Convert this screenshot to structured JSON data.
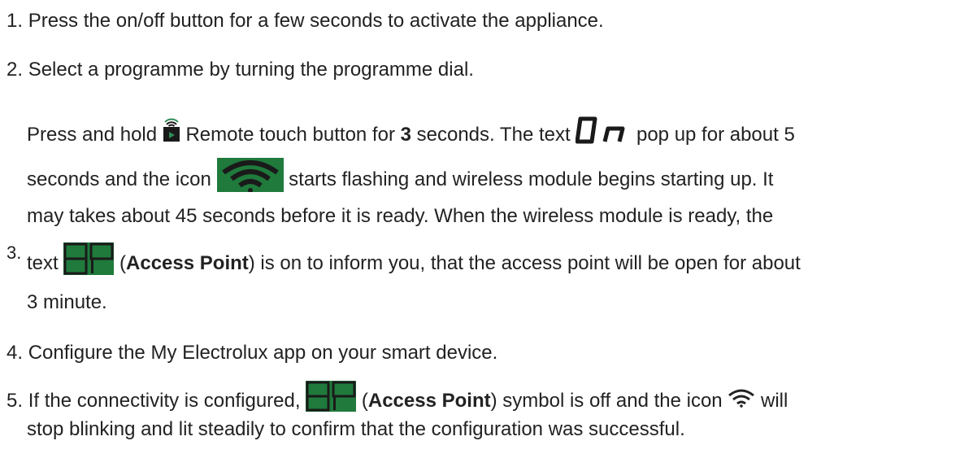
{
  "steps": [
    {
      "num": "1.",
      "text": "Press the on/off button for a few seconds to activate the appliance."
    },
    {
      "num": "2.",
      "text": "Select a programme by turning the programme dial."
    },
    {
      "num": "3.",
      "l1a": "Press and hold ",
      "l1b": " Remote touch button for ",
      "l1bold": "3",
      "l1c": " seconds. The text ",
      "l1d": " pop up for about 5",
      "l2a": "seconds and the icon ",
      "l2b": " starts flashing and wireless module begins starting up. It",
      "l3": "may takes about 45 seconds before it is ready. When the wireless module is ready, the",
      "l4a": "text ",
      "l4b": " (",
      "l4bold": "Access Point",
      "l4c": ") is on to inform you, that the access point will be open for about",
      "l5": "3 minute."
    },
    {
      "num": "4.",
      "text": "Configure the My Electrolux app on your smart device."
    },
    {
      "num": "5.",
      "l1a": "If the connectivity is configured, ",
      "l1b": " (",
      "l1bold": "Access Point",
      "l1c": ") symbol is off and the icon ",
      "l1d": " will",
      "l2": "stop blinking and lit steadily to confirm that the configuration was successful."
    }
  ],
  "icons": {
    "remote_touch": "remote-touch-icon",
    "on_display": "on-display-icon",
    "wifi_green": "wifi-icon",
    "ap_display": "access-point-display-icon",
    "wifi_outline": "wifi-outline-icon"
  },
  "colors": {
    "text": "#222222",
    "icon_green": "#1f7a3c",
    "icon_dark": "#1a1a1a"
  }
}
